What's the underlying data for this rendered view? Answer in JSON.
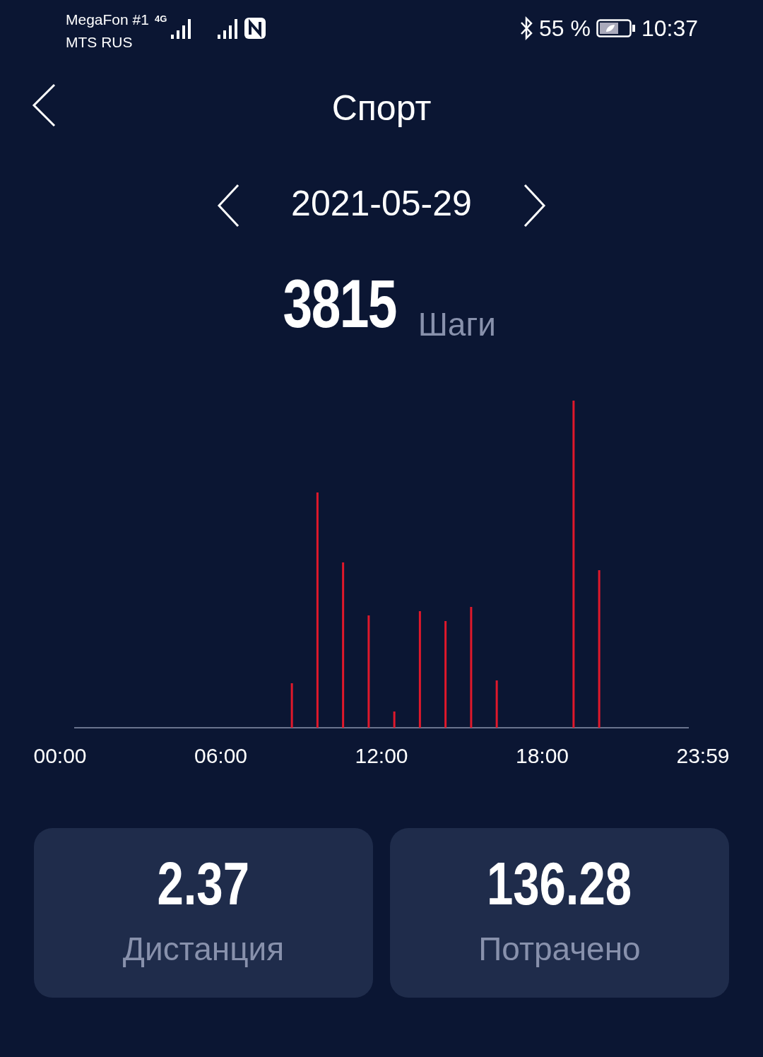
{
  "status_bar": {
    "carrier_1": "MegaFon #1",
    "carrier_2": "MTS RUS",
    "network": "4G",
    "battery": "55 %",
    "time": "10:37"
  },
  "header": {
    "title": "Спорт"
  },
  "date": "2021-05-29",
  "steps": {
    "value": "3815",
    "unit": "Шаги"
  },
  "chart": {
    "x_labels": [
      "00:00",
      "06:00",
      "12:00",
      "18:00",
      "23:59"
    ]
  },
  "cards": [
    {
      "value": "2.37",
      "label": "Дистанция"
    },
    {
      "value": "136.28",
      "label": "Потрачено"
    }
  ]
}
